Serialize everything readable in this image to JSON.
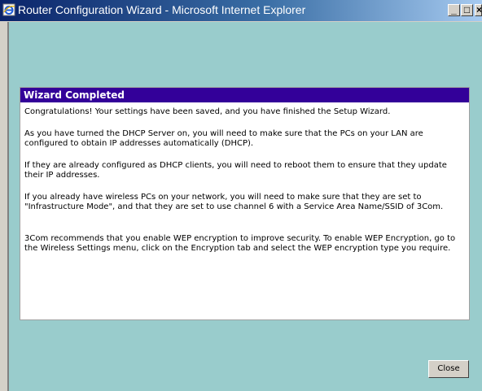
{
  "window": {
    "title": "Router Configuration Wizard - Microsoft Internet Explorer",
    "controls": {
      "minimize": "_",
      "maximize": "□",
      "close": "×"
    }
  },
  "panel": {
    "title": "Wizard Completed",
    "paragraphs": [
      "Congratulations! Your settings have been saved, and you have finished the Setup Wizard.",
      "As you have turned the DHCP Server on, you will need to make sure that the PCs on your LAN are configured to obtain IP addresses automatically (DHCP).",
      "If they are already configured as DHCP clients, you will need to reboot them to ensure that they update their IP addresses.",
      "If you already have wireless PCs on your network, you will need to make sure that they are set to \"Infrastructure Mode\", and that they are set to use channel 6 with a Service Area Name/SSID of 3Com.",
      "3Com recommends that you enable WEP encryption to improve security. To enable WEP Encryption, go to the Wireless Settings menu, click on the Encryption tab and select the WEP encryption type you require."
    ]
  },
  "buttons": {
    "close": "Close"
  },
  "colors": {
    "background": "#99cccc",
    "header": "#330099",
    "panel": "#ffffff"
  },
  "icons": {
    "app": "internet-explorer-icon"
  }
}
